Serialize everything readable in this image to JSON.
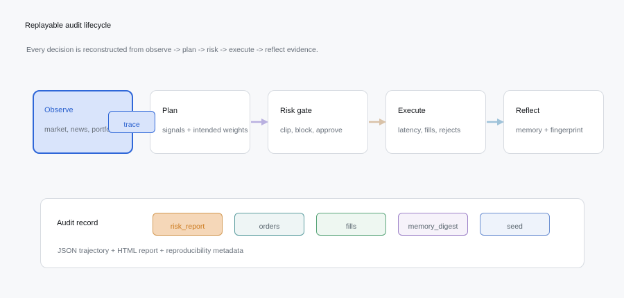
{
  "title": "Replayable audit lifecycle",
  "subtitle": "Every decision is reconstructed from observe -> plan -> risk -> execute -> reflect evidence.",
  "stages": [
    {
      "name": "Observe",
      "desc": "market, news, portfolio"
    },
    {
      "name": "Plan",
      "desc": "signals + intended weights"
    },
    {
      "name": "Risk gate",
      "desc": "clip, block, approve"
    },
    {
      "name": "Execute",
      "desc": "latency, fills, rejects"
    },
    {
      "name": "Reflect",
      "desc": "memory + fingerprint"
    }
  ],
  "trace_label": "trace",
  "arrow_colors": [
    "#b9b0e0",
    "#d9c2a8",
    "#9fc3d9"
  ],
  "audit": {
    "label": "Audit record",
    "fields": [
      "risk_report",
      "orders",
      "fills",
      "memory_digest",
      "seed"
    ],
    "footnote": "JSON trajectory + HTML report + reproducibility metadata"
  }
}
